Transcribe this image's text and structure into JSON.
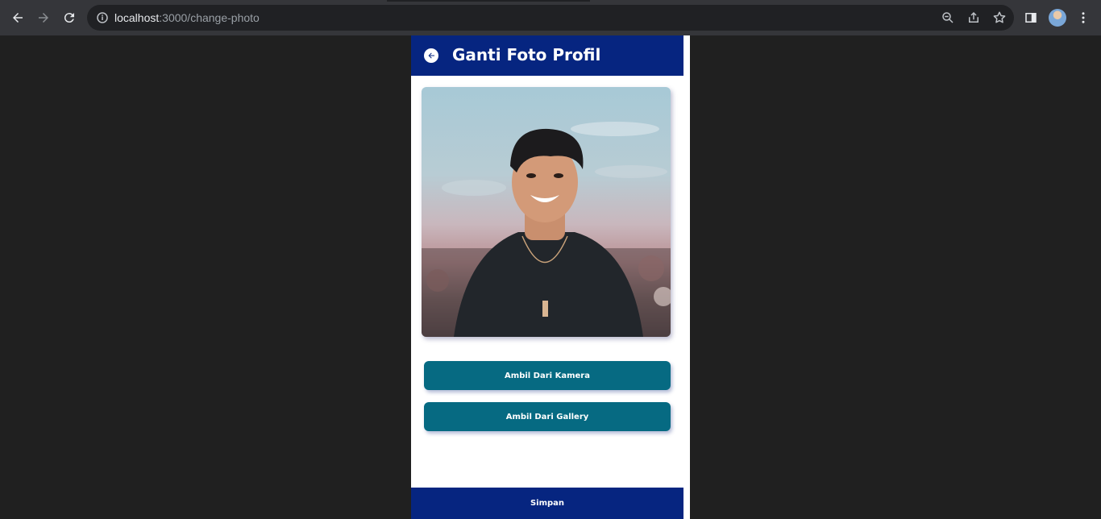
{
  "browser": {
    "url_host": "localhost",
    "url_path": ":3000/change-photo"
  },
  "header": {
    "title": "Ganti Foto Profil"
  },
  "photo": {
    "subject": "profile-photo"
  },
  "actions": {
    "camera_label": "Ambil Dari Kamera",
    "gallery_label": "Ambil Dari Gallery"
  },
  "footer": {
    "save_label": "Simpan"
  },
  "colors": {
    "primary": "#062580",
    "button": "#066a82"
  }
}
